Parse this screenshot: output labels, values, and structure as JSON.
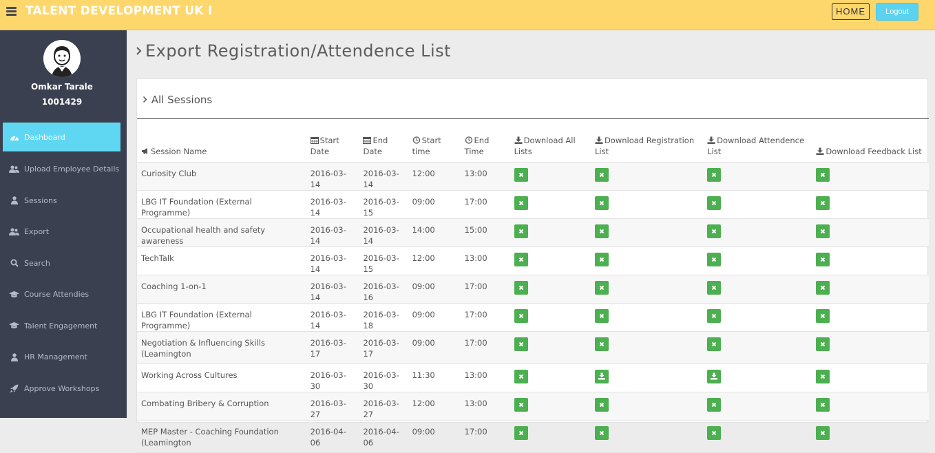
{
  "header": {
    "brand": "TALENT DEVELOPMENT UK I",
    "home_label": "HOME",
    "logout_label": "Logout"
  },
  "user": {
    "name": "Omkar Tarale",
    "id": "1001429"
  },
  "sidebar": {
    "items": [
      {
        "label": "Dashboard",
        "icon": "dashboard-icon"
      },
      {
        "label": "Upload Employee Details",
        "icon": "users-icon"
      },
      {
        "label": "Sessions",
        "icon": "user-icon"
      },
      {
        "label": "Export",
        "icon": "users-icon"
      },
      {
        "label": "Search",
        "icon": "search-icon"
      },
      {
        "label": "Course Attendies",
        "icon": "graduation-cap-icon"
      },
      {
        "label": "Talent Engagement",
        "icon": "graduation-cap-icon"
      },
      {
        "label": "HR Management",
        "icon": "user-icon"
      },
      {
        "label": "Approve Workshops",
        "icon": "rocket-icon"
      }
    ]
  },
  "main": {
    "title": "Export Registration/Attendence List",
    "panel_title": "All Sessions",
    "columns": {
      "session_name": "Session Name",
      "start_date": "Start Date",
      "end_date": "End Date",
      "start_time": "Start time",
      "end_time": "End Time",
      "dl_all": "Download All Lists",
      "dl_reg": "Download Registration List",
      "dl_att": "Download Attendence List",
      "dl_fb": "Download Feedback List"
    },
    "rows": [
      {
        "name": "Curiosity Club",
        "start_date": "2016-03-14",
        "end_date": "2016-03-14",
        "start_time": "12:00",
        "end_time": "13:00",
        "reg": "x",
        "att": "x"
      },
      {
        "name": "LBG IT Foundation (External Programme)",
        "start_date": "2016-03-14",
        "end_date": "2016-03-15",
        "start_time": "09:00",
        "end_time": "17:00",
        "reg": "x",
        "att": "x"
      },
      {
        "name": "Occupational health and safety awareness",
        "start_date": "2016-03-14",
        "end_date": "2016-03-14",
        "start_time": "14:00",
        "end_time": "15:00",
        "reg": "x",
        "att": "x"
      },
      {
        "name": "TechTalk",
        "start_date": "2016-03-14",
        "end_date": "2016-03-15",
        "start_time": "12:00",
        "end_time": "13:00",
        "reg": "x",
        "att": "x"
      },
      {
        "name": "Coaching 1-on-1",
        "start_date": "2016-03-14",
        "end_date": "2016-03-16",
        "start_time": "09:00",
        "end_time": "17:00",
        "reg": "x",
        "att": "x"
      },
      {
        "name": "LBG IT Foundation (External Programme)",
        "start_date": "2016-03-14",
        "end_date": "2016-03-18",
        "start_time": "09:00",
        "end_time": "17:00",
        "reg": "x",
        "att": "x"
      },
      {
        "name": "Negotiation & Influencing Skills (Leamington",
        "start_date": "2016-03-17",
        "end_date": "2016-03-17",
        "start_time": "09:00",
        "end_time": "17:00",
        "reg": "x",
        "att": "x"
      },
      {
        "name": "Working Across Cultures",
        "start_date": "2016-03-30",
        "end_date": "2016-03-30",
        "start_time": "11:30",
        "end_time": "13:00",
        "reg": "download",
        "att": "download"
      },
      {
        "name": "Combating Bribery & Corruption",
        "start_date": "2016-03-27",
        "end_date": "2016-03-27",
        "start_time": "12:00",
        "end_time": "13:00",
        "reg": "x",
        "att": "x"
      },
      {
        "name": "MEP Master - Coaching Foundation (Leamington",
        "start_date": "2016-04-06",
        "end_date": "2016-04-06",
        "start_time": "09:00",
        "end_time": "17:00",
        "reg": "x",
        "att": "x"
      }
    ]
  },
  "colors": {
    "topbar": "#fdd76c",
    "sidebar": "#3a4050",
    "accent": "#5fd7f2",
    "button_green": "#4caf50"
  }
}
